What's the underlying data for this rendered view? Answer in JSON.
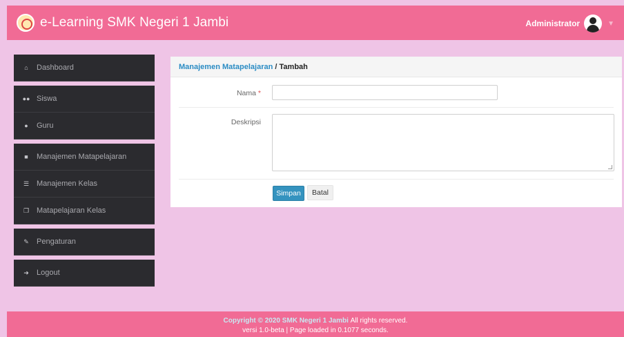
{
  "header": {
    "app_title": "e-Learning SMK Negeri 1 Jambi",
    "user_name": "Administrator",
    "dropdown_icon": "caret-down-icon",
    "brand_color": "#f16b95"
  },
  "sidebar": {
    "items": [
      {
        "label": "Dashboard",
        "icon": "home-icon"
      },
      {
        "label": "Siswa",
        "icon": "users-icon"
      },
      {
        "label": "Guru",
        "icon": "user-icon"
      },
      {
        "label": "Manajemen Matapelajaran",
        "icon": "book-icon"
      },
      {
        "label": "Manajemen Kelas",
        "icon": "list-icon"
      },
      {
        "label": "Matapelajaran Kelas",
        "icon": "copy-icon"
      },
      {
        "label": "Pengaturan",
        "icon": "wrench-icon"
      },
      {
        "label": "Logout",
        "icon": "sign-out-icon"
      }
    ]
  },
  "panel": {
    "breadcrumb_parent": "Manajemen Matapelajaran",
    "breadcrumb_separator": " / ",
    "breadcrumb_current": "Tambah"
  },
  "form": {
    "nama_label": "Nama",
    "required_mark": "*",
    "nama_value": "",
    "deskripsi_label": "Deskripsi",
    "deskripsi_value": "",
    "submit_label": "Simpan",
    "cancel_label": "Batal"
  },
  "footer": {
    "copyright": "Copyright © 2020 SMK Negeri 1 Jambi",
    "reserved": "All rights reserved.",
    "version_line": "versi 1.0-beta | Page loaded in 0.1077 seconds."
  }
}
